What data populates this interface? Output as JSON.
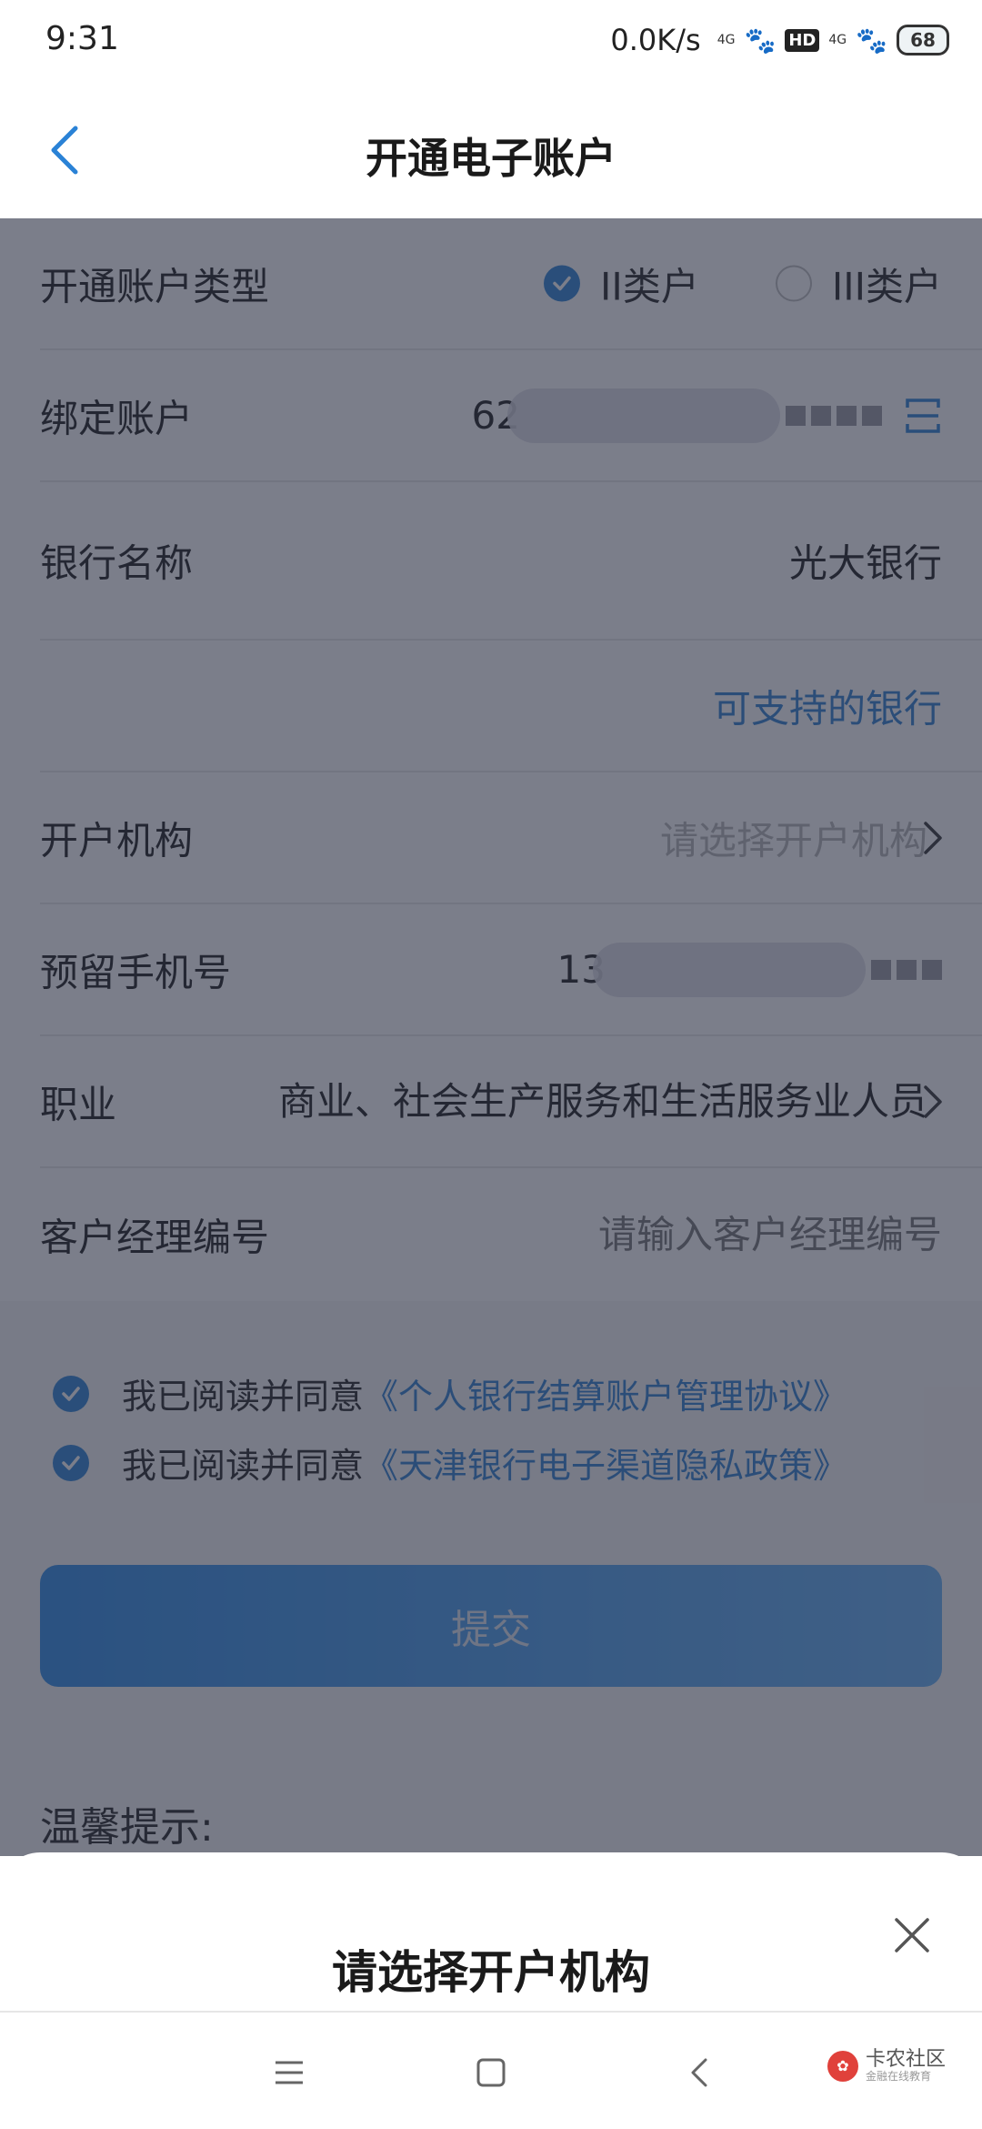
{
  "status_bar": {
    "time": "9:31",
    "net_speed": "0.0K/s",
    "signal1_label": "4G",
    "hd_label": "HD",
    "signal2_label": "4G",
    "battery": "68"
  },
  "header": {
    "title": "开通电子账户"
  },
  "form": {
    "account_type": {
      "label": "开通账户类型",
      "options": [
        {
          "label": "II类户",
          "selected": true
        },
        {
          "label": "III类户",
          "selected": false
        }
      ]
    },
    "bound_account": {
      "label": "绑定账户",
      "visible_prefix": "62"
    },
    "bank_name": {
      "label": "银行名称",
      "value": "光大银行"
    },
    "supported_banks_link": "可支持的银行",
    "branch": {
      "label": "开户机构",
      "placeholder": "请选择开户机构"
    },
    "phone": {
      "label": "预留手机号",
      "visible_prefix": "13"
    },
    "occupation": {
      "label": "职业",
      "value": "商业、社会生产服务和生活服务业人员"
    },
    "manager_id": {
      "label": "客户经理编号",
      "placeholder": "请输入客户经理编号"
    }
  },
  "agreements": [
    {
      "prefix": "我已阅读并同意",
      "link": "《个人银行结算账户管理协议》",
      "checked": true
    },
    {
      "prefix": "我已阅读并同意",
      "link": "《天津银行电子渠道隐私政策》",
      "checked": true
    }
  ],
  "submit_label": "提交",
  "tips_title": "温馨提示:",
  "sheet": {
    "title": "请选择开户机构"
  },
  "watermark": {
    "main": "卡农社区",
    "sub": "金融在线教育"
  },
  "colors": {
    "accent": "#2a82d6",
    "link": "#2f7fd0",
    "overlay": "#2a2e42"
  }
}
